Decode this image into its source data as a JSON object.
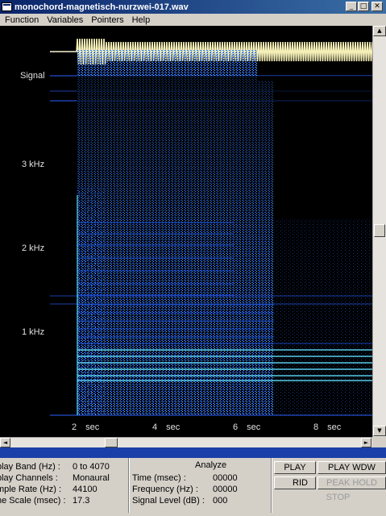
{
  "window": {
    "title": "monochord-magnetisch-nurzwei-017.wav",
    "buttons": [
      "_",
      "□",
      "✕"
    ]
  },
  "menu": [
    "Function",
    "Variables",
    "Pointers",
    "Help"
  ],
  "plot": {
    "signal_label": "Signal",
    "y_labels": [
      "3 kHz",
      "2 kHz",
      "1 kHz"
    ],
    "x_labels": [
      "2 sec",
      "4 sec",
      "6 sec",
      "8 sec"
    ],
    "colors": {
      "background": "#000000",
      "signal": "#f6f0b8",
      "spectrum_blue": "#1e5cff",
      "spectrum_cyan": "#5fe0ff"
    }
  },
  "info_left": {
    "rows": [
      {
        "label": "play Band (Hz) :",
        "value": "0 to 4070"
      },
      {
        "label": "play Channels :",
        "value": "Monaural"
      },
      {
        "label": "mple Rate (Hz) :",
        "value": "44100"
      },
      {
        "label": "ne Scale (msec) :",
        "value": "17.3"
      }
    ]
  },
  "info_analyze": {
    "title": "Analyze",
    "rows": [
      {
        "label": "Time (msec) :",
        "value": "00000"
      },
      {
        "label": "Frequency (Hz) :",
        "value": "00000"
      },
      {
        "label": "Signal Level (dB) :",
        "value": "000"
      }
    ]
  },
  "controls": {
    "play": "PLAY",
    "play_wdw": "PLAY WDW",
    "grid": "RID",
    "peak_hold": "PEAK HOLD",
    "stop": "STOP"
  },
  "scroll_icons": {
    "up": "▲",
    "down": "▼",
    "left": "◄",
    "right": "►"
  }
}
